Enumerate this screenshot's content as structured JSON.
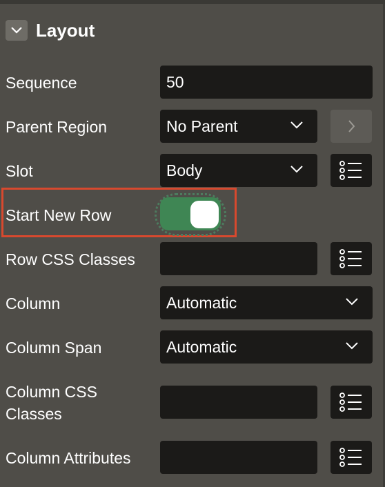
{
  "section": {
    "title": "Layout",
    "collapse_icon": "chevron-down-icon"
  },
  "fields": {
    "sequence": {
      "label": "Sequence",
      "value": "50"
    },
    "parent_region": {
      "label": "Parent Region",
      "value": "No Parent"
    },
    "slot": {
      "label": "Slot",
      "value": "Body"
    },
    "start_new_row": {
      "label": "Start New Row",
      "enabled": true
    },
    "row_css_classes": {
      "label": "Row CSS Classes",
      "value": ""
    },
    "column": {
      "label": "Column",
      "value": "Automatic"
    },
    "column_span": {
      "label": "Column Span",
      "value": "Automatic"
    },
    "column_css_classes": {
      "label_line1": "Column CSS",
      "label_line2": "Classes",
      "value": ""
    },
    "column_attributes": {
      "label": "Column Attributes",
      "value": ""
    }
  },
  "colors": {
    "panel_bg": "#4f4d48",
    "field_bg": "#1b1a18",
    "toggle_on": "#3f8654",
    "highlight_border": "#d8492e"
  },
  "icons": {
    "select": "chevron-down-icon",
    "goto": "chevron-right-icon",
    "list_picker": "list-icon"
  }
}
